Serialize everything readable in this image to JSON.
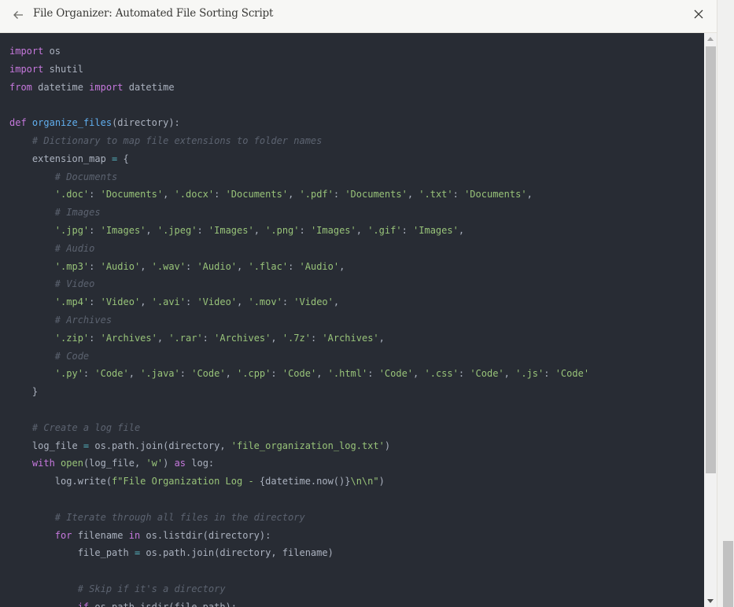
{
  "header": {
    "title": "File Organizer: Automated File Sorting Script",
    "back_icon": "arrow-left-icon",
    "close_icon": "close-icon"
  },
  "theme": {
    "background": "#282c34",
    "keyword": "#c678dd",
    "function": "#61afef",
    "string": "#98c379",
    "comment": "#5c6370",
    "operator": "#56b6c2",
    "text": "#abb2bf"
  },
  "code": {
    "language": "python",
    "lines": [
      [
        [
          "kw",
          "import"
        ],
        [
          "t",
          " os"
        ]
      ],
      [
        [
          "kw",
          "import"
        ],
        [
          "t",
          " shutil"
        ]
      ],
      [
        [
          "kw",
          "from"
        ],
        [
          "t",
          " datetime "
        ],
        [
          "kw",
          "import"
        ],
        [
          "t",
          " datetime"
        ]
      ],
      [],
      [
        [
          "kw",
          "def"
        ],
        [
          "t",
          " "
        ],
        [
          "fn",
          "organize_files"
        ],
        [
          "t",
          "(directory):"
        ]
      ],
      [
        [
          "t",
          "    "
        ],
        [
          "cm",
          "# Dictionary to map file extensions to folder names"
        ]
      ],
      [
        [
          "t",
          "    extension_map "
        ],
        [
          "op",
          "="
        ],
        [
          "t",
          " {"
        ]
      ],
      [
        [
          "t",
          "        "
        ],
        [
          "cm",
          "# Documents"
        ]
      ],
      [
        [
          "t",
          "        "
        ],
        [
          "st",
          "'.doc'"
        ],
        [
          "t",
          ": "
        ],
        [
          "st",
          "'Documents'"
        ],
        [
          "t",
          ", "
        ],
        [
          "st",
          "'.docx'"
        ],
        [
          "t",
          ": "
        ],
        [
          "st",
          "'Documents'"
        ],
        [
          "t",
          ", "
        ],
        [
          "st",
          "'.pdf'"
        ],
        [
          "t",
          ": "
        ],
        [
          "st",
          "'Documents'"
        ],
        [
          "t",
          ", "
        ],
        [
          "st",
          "'.txt'"
        ],
        [
          "t",
          ": "
        ],
        [
          "st",
          "'Documents'"
        ],
        [
          "t",
          ","
        ]
      ],
      [
        [
          "t",
          "        "
        ],
        [
          "cm",
          "# Images"
        ]
      ],
      [
        [
          "t",
          "        "
        ],
        [
          "st",
          "'.jpg'"
        ],
        [
          "t",
          ": "
        ],
        [
          "st",
          "'Images'"
        ],
        [
          "t",
          ", "
        ],
        [
          "st",
          "'.jpeg'"
        ],
        [
          "t",
          ": "
        ],
        [
          "st",
          "'Images'"
        ],
        [
          "t",
          ", "
        ],
        [
          "st",
          "'.png'"
        ],
        [
          "t",
          ": "
        ],
        [
          "st",
          "'Images'"
        ],
        [
          "t",
          ", "
        ],
        [
          "st",
          "'.gif'"
        ],
        [
          "t",
          ": "
        ],
        [
          "st",
          "'Images'"
        ],
        [
          "t",
          ","
        ]
      ],
      [
        [
          "t",
          "        "
        ],
        [
          "cm",
          "# Audio"
        ]
      ],
      [
        [
          "t",
          "        "
        ],
        [
          "st",
          "'.mp3'"
        ],
        [
          "t",
          ": "
        ],
        [
          "st",
          "'Audio'"
        ],
        [
          "t",
          ", "
        ],
        [
          "st",
          "'.wav'"
        ],
        [
          "t",
          ": "
        ],
        [
          "st",
          "'Audio'"
        ],
        [
          "t",
          ", "
        ],
        [
          "st",
          "'.flac'"
        ],
        [
          "t",
          ": "
        ],
        [
          "st",
          "'Audio'"
        ],
        [
          "t",
          ","
        ]
      ],
      [
        [
          "t",
          "        "
        ],
        [
          "cm",
          "# Video"
        ]
      ],
      [
        [
          "t",
          "        "
        ],
        [
          "st",
          "'.mp4'"
        ],
        [
          "t",
          ": "
        ],
        [
          "st",
          "'Video'"
        ],
        [
          "t",
          ", "
        ],
        [
          "st",
          "'.avi'"
        ],
        [
          "t",
          ": "
        ],
        [
          "st",
          "'Video'"
        ],
        [
          "t",
          ", "
        ],
        [
          "st",
          "'.mov'"
        ],
        [
          "t",
          ": "
        ],
        [
          "st",
          "'Video'"
        ],
        [
          "t",
          ","
        ]
      ],
      [
        [
          "t",
          "        "
        ],
        [
          "cm",
          "# Archives"
        ]
      ],
      [
        [
          "t",
          "        "
        ],
        [
          "st",
          "'.zip'"
        ],
        [
          "t",
          ": "
        ],
        [
          "st",
          "'Archives'"
        ],
        [
          "t",
          ", "
        ],
        [
          "st",
          "'.rar'"
        ],
        [
          "t",
          ": "
        ],
        [
          "st",
          "'Archives'"
        ],
        [
          "t",
          ", "
        ],
        [
          "st",
          "'.7z'"
        ],
        [
          "t",
          ": "
        ],
        [
          "st",
          "'Archives'"
        ],
        [
          "t",
          ","
        ]
      ],
      [
        [
          "t",
          "        "
        ],
        [
          "cm",
          "# Code"
        ]
      ],
      [
        [
          "t",
          "        "
        ],
        [
          "st",
          "'.py'"
        ],
        [
          "t",
          ": "
        ],
        [
          "st",
          "'Code'"
        ],
        [
          "t",
          ", "
        ],
        [
          "st",
          "'.java'"
        ],
        [
          "t",
          ": "
        ],
        [
          "st",
          "'Code'"
        ],
        [
          "t",
          ", "
        ],
        [
          "st",
          "'.cpp'"
        ],
        [
          "t",
          ": "
        ],
        [
          "st",
          "'Code'"
        ],
        [
          "t",
          ", "
        ],
        [
          "st",
          "'.html'"
        ],
        [
          "t",
          ": "
        ],
        [
          "st",
          "'Code'"
        ],
        [
          "t",
          ", "
        ],
        [
          "st",
          "'.css'"
        ],
        [
          "t",
          ": "
        ],
        [
          "st",
          "'Code'"
        ],
        [
          "t",
          ", "
        ],
        [
          "st",
          "'.js'"
        ],
        [
          "t",
          ": "
        ],
        [
          "st",
          "'Code'"
        ]
      ],
      [
        [
          "t",
          "    }"
        ]
      ],
      [],
      [
        [
          "t",
          "    "
        ],
        [
          "cm",
          "# Create a log file"
        ]
      ],
      [
        [
          "t",
          "    log_file "
        ],
        [
          "op",
          "="
        ],
        [
          "t",
          " os.path.join(directory, "
        ],
        [
          "st",
          "'file_organization_log.txt'"
        ],
        [
          "t",
          ")"
        ]
      ],
      [
        [
          "t",
          "    "
        ],
        [
          "kw",
          "with"
        ],
        [
          "t",
          " "
        ],
        [
          "bi",
          "open"
        ],
        [
          "t",
          "(log_file, "
        ],
        [
          "st",
          "'w'"
        ],
        [
          "t",
          ") "
        ],
        [
          "kw",
          "as"
        ],
        [
          "t",
          " log:"
        ]
      ],
      [
        [
          "t",
          "        log.write("
        ],
        [
          "st",
          "f\"File Organization Log - "
        ],
        [
          "t",
          "{datetime.now()}"
        ],
        [
          "st",
          "\\n\\n\""
        ],
        [
          "t",
          ")"
        ]
      ],
      [],
      [
        [
          "t",
          "        "
        ],
        [
          "cm",
          "# Iterate through all files in the directory"
        ]
      ],
      [
        [
          "t",
          "        "
        ],
        [
          "kw",
          "for"
        ],
        [
          "t",
          " filename "
        ],
        [
          "kw",
          "in"
        ],
        [
          "t",
          " os.listdir(directory):"
        ]
      ],
      [
        [
          "t",
          "            file_path "
        ],
        [
          "op",
          "="
        ],
        [
          "t",
          " os.path.join(directory, filename)"
        ]
      ],
      [],
      [
        [
          "t",
          "            "
        ],
        [
          "cm",
          "# Skip if it's a directory"
        ]
      ],
      [
        [
          "t",
          "            "
        ],
        [
          "kw",
          "if"
        ],
        [
          "t",
          " os.path.isdir(file_path):"
        ]
      ]
    ]
  },
  "scrollbars": {
    "code_scroll_fraction": 0.0,
    "page_scroll_fraction": 1.0
  }
}
